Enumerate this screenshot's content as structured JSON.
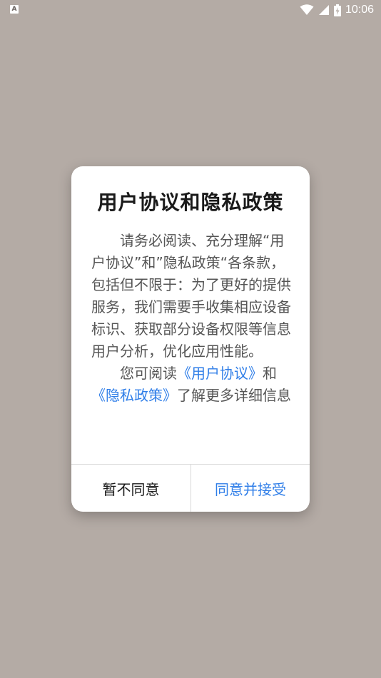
{
  "status_bar": {
    "left_badge": "A",
    "time": "10:06",
    "icons": [
      "wifi-icon",
      "signal-icon",
      "battery-charging-icon"
    ]
  },
  "dialog": {
    "title": "用户协议和隐私政策",
    "paragraph1": "请务必阅读、充分理解“用户协议”和”隐私政策“各条款，包括但不限于：为了更好的提供服务，我们需要手收集相应设备标识、获取部分设备权限等信息用户分析，优化应用性能。",
    "paragraph2_prefix": "您可阅读",
    "user_agreement_link": "《用户协议》",
    "paragraph2_and": "和",
    "privacy_policy_link": "《隐私政策》",
    "paragraph2_suffix": "了解更多详细信息",
    "decline_label": "暂不同意",
    "accept_label": "同意并接受"
  },
  "colors": {
    "backdrop": "#b4aba5",
    "link": "#2f7ee8",
    "title": "#1a1a1a",
    "body_text": "#555555"
  }
}
